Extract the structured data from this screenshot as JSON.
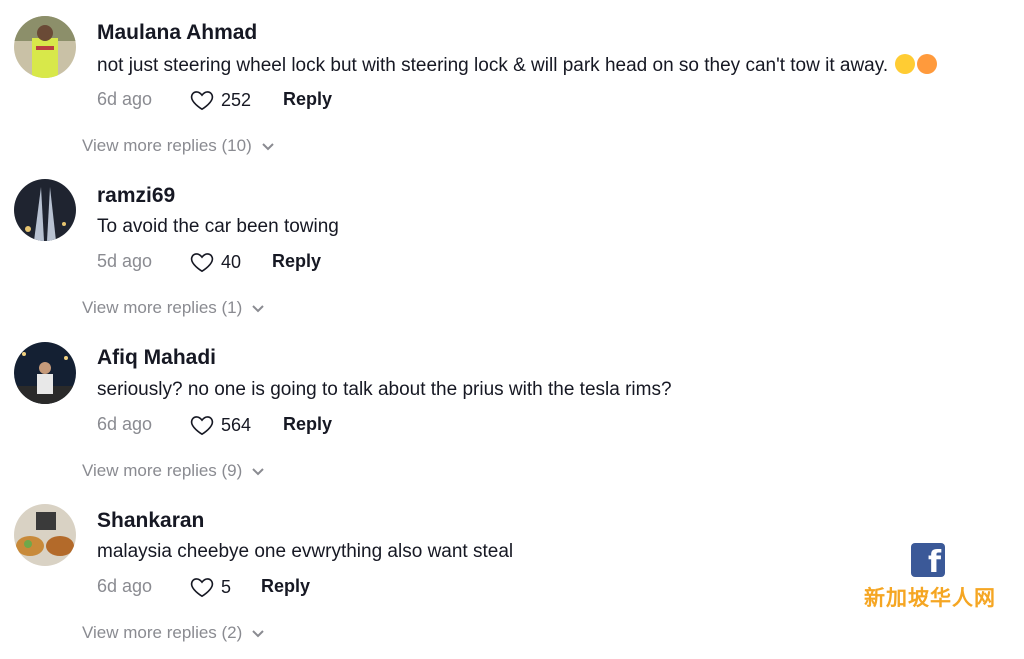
{
  "comments": [
    {
      "username": "Maulana Ahmad",
      "text": "not just steering wheel lock but with steering lock & will park head on so they can't tow it away.",
      "emojis": [
        "grinning-face",
        "smiling-face-with-hearts"
      ],
      "time": "6d ago",
      "likes": "252",
      "reply_label": "Reply",
      "more_replies": "View more replies (10)"
    },
    {
      "username": "ramzi69",
      "text": "To avoid the car been towing",
      "time": "5d ago",
      "likes": "40",
      "reply_label": "Reply",
      "more_replies": "View more replies (1)"
    },
    {
      "username": "Afiq Mahadi",
      "text": "seriously? no one is going to talk about the prius with the tesla rims?",
      "time": "6d ago",
      "likes": "564",
      "reply_label": "Reply",
      "more_replies": "View more replies (9)"
    },
    {
      "username": "Shankaran",
      "text": "malaysia cheebye one evwrything also want steal",
      "time": "6d ago",
      "likes": "5",
      "reply_label": "Reply",
      "more_replies": "View more replies (2)"
    }
  ],
  "watermark": {
    "icon": "facebook-icon",
    "text": "新加坡华人网"
  },
  "colors": {
    "primary_text": "#161823",
    "secondary_text": "#8a8b91",
    "watermark_orange": "#f5a623",
    "facebook_blue": "#3b5998"
  }
}
